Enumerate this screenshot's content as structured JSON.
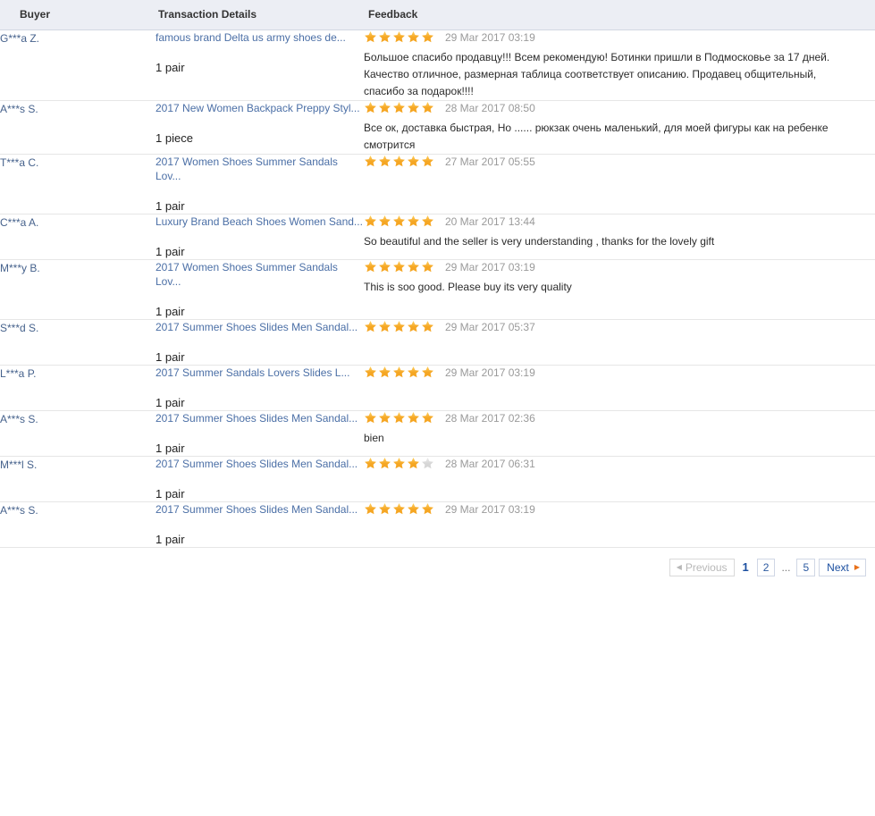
{
  "table": {
    "columns": {
      "buyer": "Buyer",
      "transaction": "Transaction Details",
      "feedback": "Feedback"
    },
    "rows": [
      {
        "buyer": "G***a Z.",
        "title": "famous brand Delta us army shoes de...",
        "quantity": "1 pair",
        "rating": 5,
        "date": "29 Mar 2017 03:19",
        "comment": "Большое спасибо продавцу!!! Всем рекомендую! Ботинки пришли в Подмосковье за 17 дней. Качество отличное, размерная таблица соответствует описанию. Продавец общительный, спасибо за подарок!!!!"
      },
      {
        "buyer": "A***s S.",
        "title": "2017 New Women Backpack Preppy Styl...",
        "quantity": "1 piece",
        "rating": 5,
        "date": "28 Mar 2017 08:50",
        "comment": "Все ок, доставка быстрая, Но ...... рюкзак очень маленький, для моей фигуры как на ребенке смотрится"
      },
      {
        "buyer": "T***a C.",
        "title": "2017 Women Shoes Summer Sandals Lov...",
        "quantity": "1 pair",
        "rating": 5,
        "date": "27 Mar 2017 05:55",
        "comment": ""
      },
      {
        "buyer": "C***a A.",
        "title": "Luxury Brand Beach Shoes Women Sand...",
        "quantity": "1 pair",
        "rating": 5,
        "date": "20 Mar 2017 13:44",
        "comment": "So beautiful and the seller is very understanding , thanks for the lovely gift"
      },
      {
        "buyer": "M***y B.",
        "title": "2017 Women Shoes Summer Sandals Lov...",
        "quantity": "1 pair",
        "rating": 5,
        "date": "29 Mar 2017 03:19",
        "comment": "This is soo good. Please buy its very quality"
      },
      {
        "buyer": "S***d S.",
        "title": "2017 Summer Shoes Slides Men Sandal...",
        "quantity": "1 pair",
        "rating": 5,
        "date": "29 Mar 2017 05:37",
        "comment": ""
      },
      {
        "buyer": "L***a P.",
        "title": "2017 Summer Sandals Lovers Slides L...",
        "quantity": "1 pair",
        "rating": 5,
        "date": "29 Mar 2017 03:19",
        "comment": ""
      },
      {
        "buyer": "A***s S.",
        "title": "2017 Summer Shoes Slides Men Sandal...",
        "quantity": "1 pair",
        "rating": 5,
        "date": "28 Mar 2017 02:36",
        "comment": "bien"
      },
      {
        "buyer": "M***l S.",
        "title": "2017 Summer Shoes Slides Men Sandal...",
        "quantity": "1 pair",
        "rating": 4,
        "date": "28 Mar 2017 06:31",
        "comment": ""
      },
      {
        "buyer": "A***s S.",
        "title": "2017 Summer Shoes Slides Men Sandal...",
        "quantity": "1 pair",
        "rating": 5,
        "date": "29 Mar 2017 03:19",
        "comment": ""
      }
    ]
  },
  "pagination": {
    "previous_label": "Previous",
    "next_label": "Next",
    "ellipsis": "...",
    "current_page": "1",
    "pages": [
      "1",
      "2",
      "...",
      "5"
    ],
    "previous_enabled": false,
    "next_enabled": true
  },
  "colors": {
    "star_filled": "#f5a623",
    "star_empty": "#d6d6d6",
    "link": "#4b6fa6",
    "header_bg": "#eceef4",
    "next_arrow": "#e8711a"
  }
}
